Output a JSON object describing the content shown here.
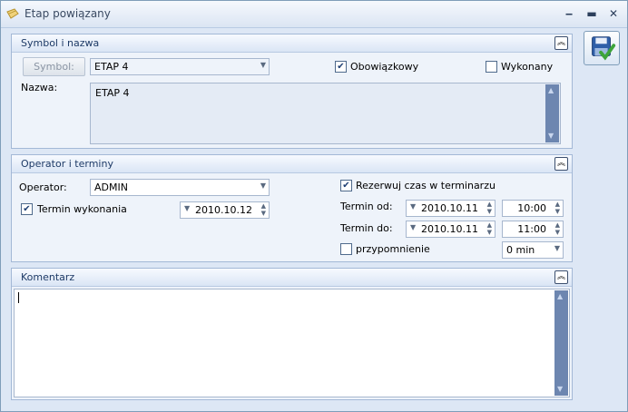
{
  "window": {
    "title": "Etap powiązany"
  },
  "panels": {
    "symbol": {
      "title": "Symbol i nazwa",
      "symbol_button": "Symbol:",
      "symbol_value": "ETAP 4",
      "obowiazkowy_label": "Obowiązkowy",
      "obowiazkowy_checked": true,
      "wykonany_label": "Wykonany",
      "wykonany_checked": false,
      "nazwa_label": "Nazwa:",
      "nazwa_value": "ETAP 4"
    },
    "operator": {
      "title": "Operator i terminy",
      "operator_label": "Operator:",
      "operator_value": "ADMIN",
      "termin_wykonania_label": "Termin wykonania",
      "termin_wykonania_checked": true,
      "termin_wykonania_date": "2010.10.12",
      "rezerwuj_label": "Rezerwuj czas w terminarzu",
      "rezerwuj_checked": true,
      "termin_od_label": "Termin od:",
      "termin_od_date": "2010.10.11",
      "termin_od_time": "10:00",
      "termin_do_label": "Termin do:",
      "termin_do_date": "2010.10.11",
      "termin_do_time": "11:00",
      "przypomnienie_label": "przypomnienie",
      "przypomnienie_checked": false,
      "przypomnienie_value": "0 min"
    },
    "komentarz": {
      "title": "Komentarz",
      "value": ""
    }
  },
  "colors": {
    "accent": "#1d3a66",
    "scrollbar": "#6d86b0",
    "panel_bg": "#eef3fa"
  }
}
